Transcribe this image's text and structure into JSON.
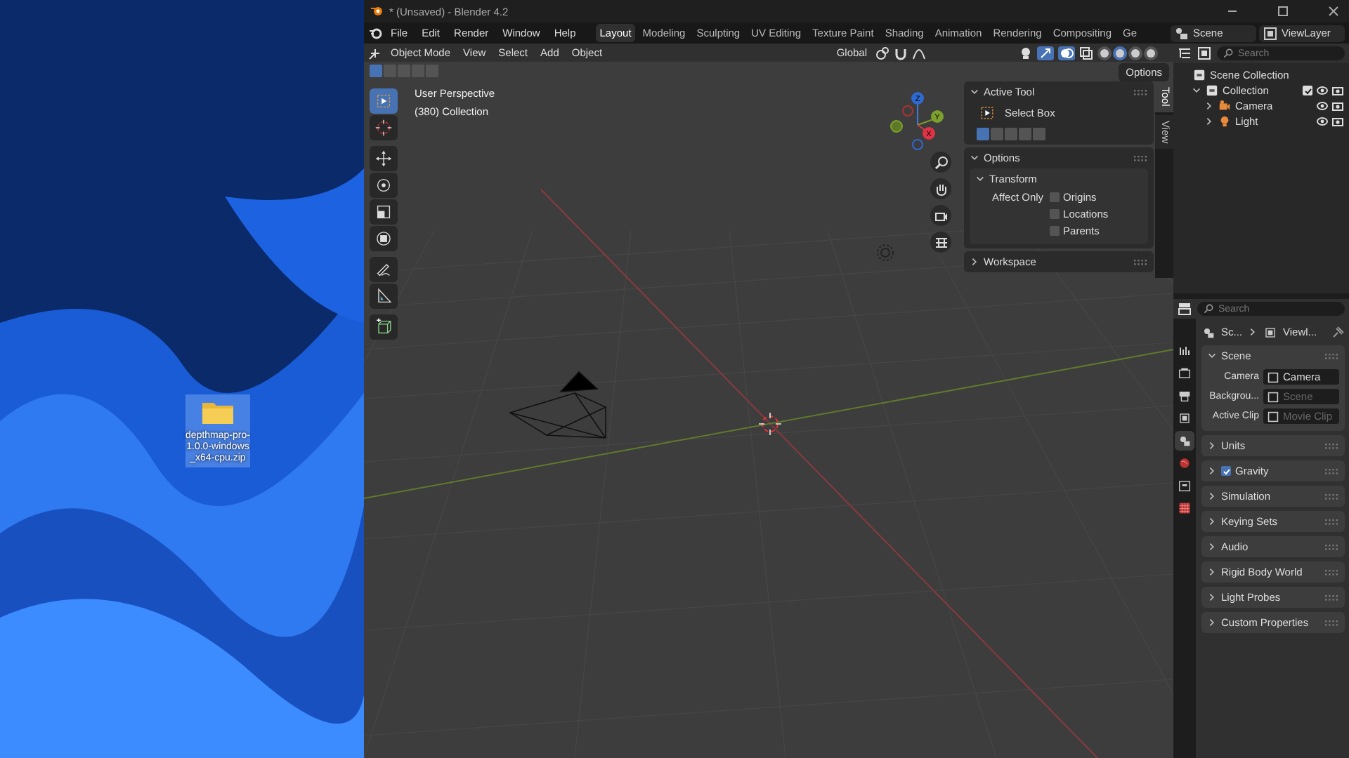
{
  "desktop": {
    "icon_label": "depthmap-pro-1.0.0-windows_x64-cpu.zip",
    "selected": true
  },
  "window": {
    "title": "* (Unsaved) - Blender 4.2"
  },
  "menu": [
    "File",
    "Edit",
    "Render",
    "Window",
    "Help"
  ],
  "workspaces": [
    {
      "label": "Layout",
      "selected": true
    },
    {
      "label": "Modeling",
      "selected": false
    },
    {
      "label": "Sculpting",
      "selected": false
    },
    {
      "label": "UV Editing",
      "selected": false
    },
    {
      "label": "Texture Paint",
      "selected": false
    },
    {
      "label": "Shading",
      "selected": false
    },
    {
      "label": "Animation",
      "selected": false
    },
    {
      "label": "Rendering",
      "selected": false
    },
    {
      "label": "Compositing",
      "selected": false
    },
    {
      "label": "Ge",
      "selected": false
    }
  ],
  "scene_selector": {
    "value": "Scene"
  },
  "view_layer": {
    "value": "ViewLayer"
  },
  "viewport": {
    "mode": "Object Mode",
    "menus": [
      "View",
      "Select",
      "Add",
      "Object"
    ],
    "orientation": "Global",
    "gizmos_on": true,
    "overlays_on": true,
    "shading": [
      {
        "selected": false
      },
      {
        "selected": true
      },
      {
        "selected": false
      },
      {
        "selected": false
      }
    ],
    "select_modes": [
      {
        "selected": true
      },
      {
        "selected": false
      },
      {
        "selected": false
      },
      {
        "selected": false
      },
      {
        "selected": false
      }
    ],
    "options": "Options",
    "overlay_lines": [
      "User Perspective",
      "(380) Collection"
    ],
    "axes": [
      "Z",
      "Y",
      "X"
    ],
    "tools": [
      {
        "kind": "select",
        "selected": true
      },
      {
        "kind": "cursor",
        "selected": false
      },
      {
        "kind": "move",
        "selected": false
      },
      {
        "kind": "rotate",
        "selected": false
      },
      {
        "kind": "scale",
        "selected": false
      },
      {
        "kind": "transform",
        "selected": false
      },
      {
        "kind": "annotate",
        "selected": false
      },
      {
        "kind": "measure",
        "selected": false
      },
      {
        "kind": "add-cube",
        "selected": false
      }
    ]
  },
  "sidebar": {
    "tabs": [
      {
        "label": "Tool",
        "selected": true
      },
      {
        "label": "View",
        "selected": false
      }
    ],
    "active_tool": {
      "heading": "Active Tool",
      "name": "Select Box",
      "modes": [
        {
          "selected": true
        },
        {
          "selected": false
        },
        {
          "selected": false
        },
        {
          "selected": false
        },
        {
          "selected": false
        }
      ]
    },
    "options": {
      "heading": "Options",
      "transform": "Transform",
      "affect_only": "Affect Only",
      "checks": [
        {
          "label": "Origins",
          "checked": false
        },
        {
          "label": "Locations",
          "checked": false
        },
        {
          "label": "Parents",
          "checked": false
        }
      ]
    },
    "workspace": "Workspace"
  },
  "outliner": {
    "search": {
      "placeholder": "Search"
    },
    "tree": [
      {
        "label": "Scene Collection",
        "kind": "scene",
        "children": [
          {
            "label": "Collection",
            "kind": "collection",
            "expanded": true,
            "checked": true,
            "children": [
              {
                "label": "Camera",
                "kind": "camera",
                "expanded": false
              },
              {
                "label": "Light",
                "kind": "light",
                "expanded": false
              }
            ]
          }
        ]
      }
    ]
  },
  "properties": {
    "search": {
      "placeholder": "Search"
    },
    "breadcrumb": [
      "Sc...",
      "Viewl..."
    ],
    "tabs": [
      {
        "kind": "tool",
        "selected": false
      },
      {
        "kind": "render",
        "selected": false
      },
      {
        "kind": "output",
        "selected": false
      },
      {
        "kind": "view-layer",
        "selected": false
      },
      {
        "kind": "scene",
        "selected": true
      },
      {
        "kind": "world",
        "selected": false
      },
      {
        "kind": "collection",
        "selected": false
      },
      {
        "kind": "texture",
        "selected": false
      }
    ],
    "panels": [
      {
        "title": "Scene",
        "expanded": true,
        "fields": [
          {
            "label": "Camera",
            "value": "Camera"
          },
          {
            "label": "Backgrou...",
            "placeholder": "Scene"
          },
          {
            "label": "Active Clip",
            "placeholder": "Movie Clip"
          }
        ]
      },
      {
        "title": "Units",
        "expanded": false
      },
      {
        "title": "Gravity",
        "expanded": false,
        "kind": "checkbox",
        "checked": true
      },
      {
        "title": "Simulation",
        "expanded": false
      },
      {
        "title": "Keying Sets",
        "expanded": false
      },
      {
        "title": "Audio",
        "expanded": false
      },
      {
        "title": "Rigid Body World",
        "expanded": false
      },
      {
        "title": "Light Probes",
        "expanded": false
      },
      {
        "title": "Custom Properties",
        "expanded": false
      }
    ]
  }
}
